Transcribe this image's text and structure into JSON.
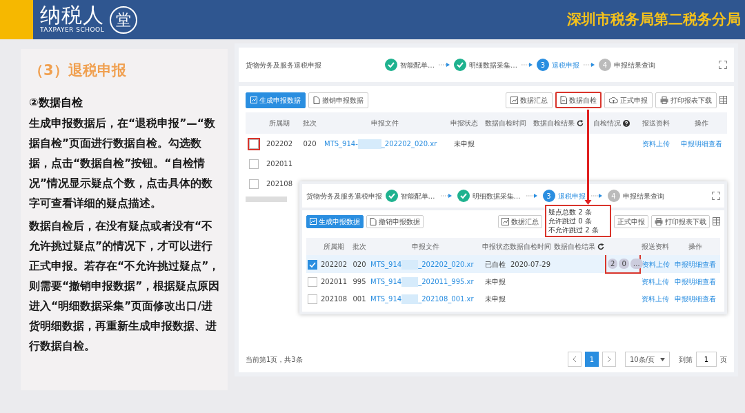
{
  "header": {
    "logo_text": "纳税人",
    "logo_subtitle": "TAXPAYER SCHOOL",
    "logo_badge": "堂",
    "org": "深圳市税务局第二税务分局"
  },
  "lesson": {
    "heading": "（3）退税申报",
    "subheading": "②数据自检",
    "paragraphs": [
      "生成申报数据后，在“退税申报”—“数据自检”页面进行数据自检。勾选数据，点击“数据自检”按钮。“自检情况”情况显示疑点个数，点击具体的数字可查看详细的疑点描述。",
      "数据自检后，在没有疑点或者没有“不允许挑过疑点”的情况下，才可以进行正式申报。若存在“不允许挑过疑点”，则需要“撤销申报数据”，根据疑点原因进入“明细数据采集”页面修改出口/进货明细数据，再重新生成申报数据、进行数据自检。"
    ]
  },
  "screens": [
    {
      "title": "货物劳务及服务退税申报",
      "steps": [
        {
          "label": "智能配单…",
          "completed": true,
          "selected": false
        },
        {
          "label": "明细数据采集…",
          "completed": true,
          "selected": false
        },
        {
          "number": "3",
          "label": "退税申报",
          "completed": false,
          "selected": true
        },
        {
          "number": "4",
          "label": "申报结果查询",
          "completed": false,
          "selected": false
        }
      ],
      "toolbar_left": [
        {
          "label": "生成申报数据",
          "primary": true
        },
        {
          "label": "撤销申报数据",
          "primary": false
        }
      ],
      "toolbar_right": [
        {
          "label": "数据汇总",
          "highlighted": false
        },
        {
          "label": "数据自检",
          "highlighted": true
        },
        {
          "label": "正式申报",
          "highlighted": false
        },
        {
          "label": "打印报表下载",
          "highlighted": false
        }
      ],
      "columns": [
        {
          "label": "所属期"
        },
        {
          "label": "批次"
        },
        {
          "label": "申报文件"
        },
        {
          "label": "申报状态"
        },
        {
          "label": "数据自检时间"
        },
        {
          "label": "数据自检结果"
        },
        {
          "label": "自检情况"
        },
        {
          "label": "报送资料"
        },
        {
          "label": "操作"
        }
      ],
      "rows": [
        {
          "checked": false,
          "selected": false,
          "highlighted": true,
          "period": "202202",
          "batch": "020",
          "file_prefix": "MTS_914-",
          "file_suffix": "_202202_020.xr",
          "status": "未申报",
          "docs": "资料上传",
          "action": "申报明细查看"
        },
        {
          "checked": false,
          "selected": false,
          "highlighted": false,
          "period": "202011"
        },
        {
          "checked": false,
          "selected": false,
          "highlighted": false,
          "period": "202108"
        }
      ],
      "footer": {
        "summary": "当前第1页，共3条",
        "pages": [
          {
            "label": "1",
            "selected": true
          }
        ],
        "page_size": "10条/页",
        "goto_label": "到第",
        "goto_value": "1",
        "goto_unit": "页"
      }
    },
    {
      "title": "货物劳务及服务退税申报",
      "steps": [
        {
          "label": "智能配单…",
          "completed": true,
          "selected": false
        },
        {
          "label": "明细数据采集…",
          "completed": true,
          "selected": false
        },
        {
          "number": "3",
          "label": "退税申报",
          "completed": false,
          "selected": true
        },
        {
          "number": "4",
          "label": "申报结果查询",
          "completed": false,
          "selected": false
        }
      ],
      "toolbar_left": [
        {
          "label": "生成申报数据",
          "primary": true
        },
        {
          "label": "撤销申报数据",
          "primary": false
        }
      ],
      "toolbar_right": [
        {
          "label": "数据汇总",
          "highlighted": false
        },
        {
          "label": "正式申报",
          "highlighted": false
        },
        {
          "label": "打印报表下载",
          "highlighted": false
        }
      ],
      "columns": [
        {
          "label": "所属期"
        },
        {
          "label": "批次"
        },
        {
          "label": "申报文件"
        },
        {
          "label": "申报状态"
        },
        {
          "label": "数据自检时间"
        },
        {
          "label": "数据自检结果"
        },
        {},
        {
          "label": "报送资料"
        },
        {
          "label": "操作"
        }
      ],
      "popover": {
        "lines": [
          "疑点总数 2 条",
          "允许跳过 0 条",
          "不允许跳过 2 条"
        ],
        "highlighted": true
      },
      "rows": [
        {
          "checked": true,
          "selected": true,
          "highlighted": false,
          "period": "202202",
          "batch": "020",
          "file_prefix": "MTS_914",
          "file_suffix": "_202202_020.xr",
          "status": "已自检",
          "check_time": "2020-07-29",
          "check_summary": [
            "2",
            "0",
            "…"
          ],
          "docs": "资料上传",
          "action": "申报明细查看"
        },
        {
          "checked": false,
          "selected": false,
          "highlighted": false,
          "period": "202011",
          "batch": "995",
          "file_prefix": "MTS_914",
          "file_suffix": "_202011_995.xr",
          "status": "未申报",
          "docs": "资料上传",
          "action": "申报明细查看"
        },
        {
          "checked": false,
          "selected": false,
          "highlighted": false,
          "period": "202108",
          "batch": "001",
          "file_prefix": "MTS_914",
          "file_suffix": "_202108_001.xr",
          "status": "未申报",
          "docs": "资料上传",
          "action": "申报明细查看"
        }
      ]
    }
  ]
}
